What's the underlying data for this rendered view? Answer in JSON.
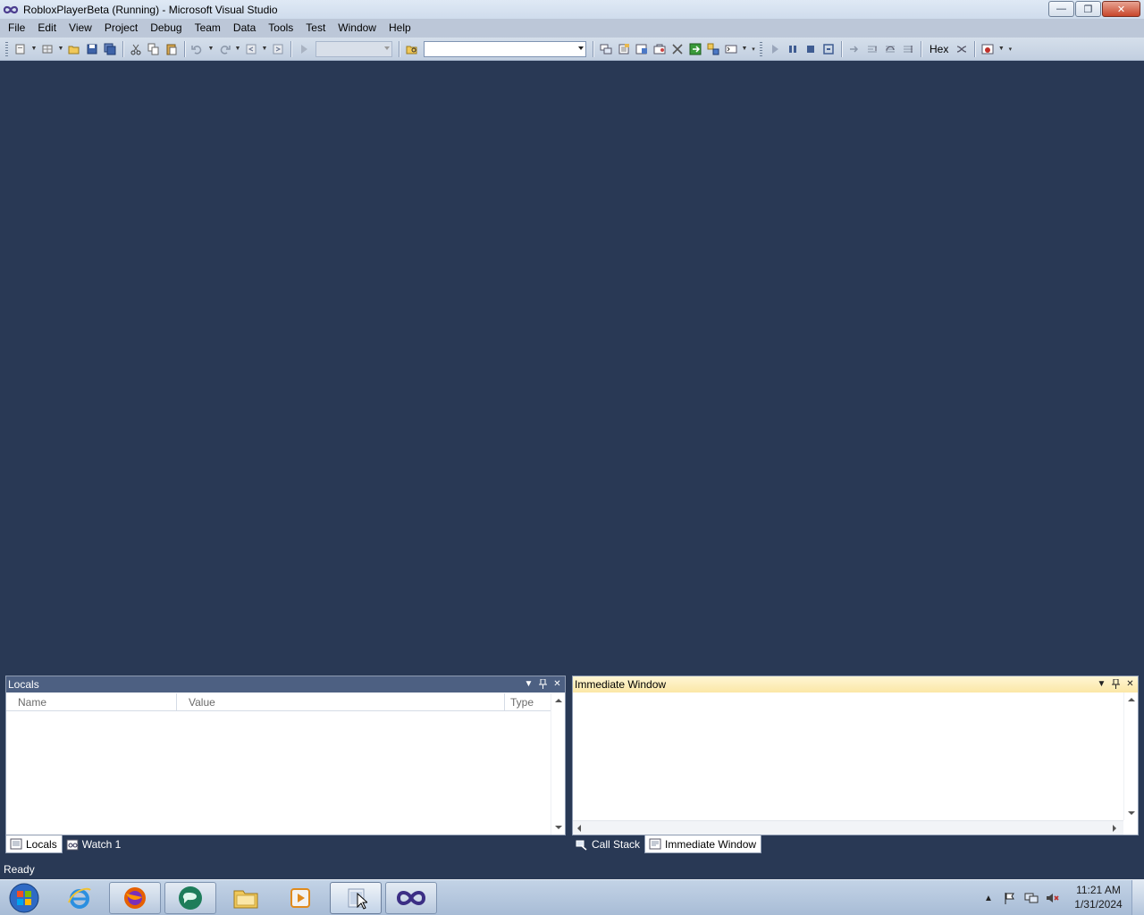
{
  "window": {
    "title": "RobloxPlayerBeta (Running) - Microsoft Visual Studio",
    "minimize": "—",
    "restore": "❐",
    "close": "✕"
  },
  "menu": [
    "File",
    "Edit",
    "View",
    "Project",
    "Debug",
    "Team",
    "Data",
    "Tools",
    "Test",
    "Window",
    "Help"
  ],
  "toolbar": {
    "hex_label": "Hex",
    "search_combo_value": "",
    "config_combo_value": ""
  },
  "locals": {
    "title": "Locals",
    "columns": [
      "Name",
      "Value",
      "Type"
    ]
  },
  "immediate": {
    "title": "Immediate Window"
  },
  "left_tabs": [
    "Locals",
    "Watch 1"
  ],
  "right_tabs": [
    "Call Stack",
    "Immediate Window"
  ],
  "status": "Ready",
  "clock": {
    "time": "11:21 AM",
    "date": "1/31/2024"
  },
  "icons": {
    "pin": "pin-icon",
    "dropdown": "dropdown-arrow-icon",
    "close": "close-icon"
  },
  "colors": {
    "workspace": "#293955",
    "active_header": "#fbe7a6",
    "inactive_header": "#4d6082"
  }
}
